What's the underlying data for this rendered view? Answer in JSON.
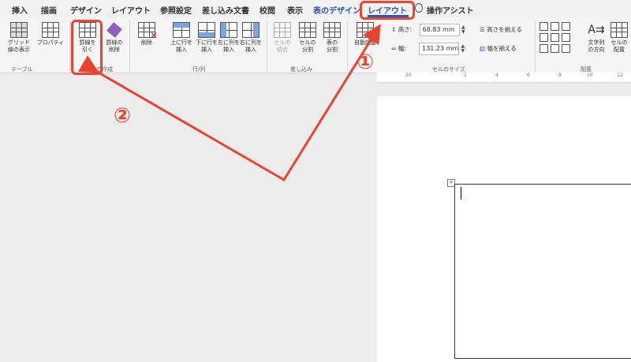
{
  "tabs": [
    {
      "label": "挿入",
      "kind": "normal"
    },
    {
      "label": "描画",
      "kind": "normal"
    },
    {
      "label": "デザイン",
      "kind": "normal"
    },
    {
      "label": "レイアウト",
      "kind": "normal"
    },
    {
      "label": "参照設定",
      "kind": "normal"
    },
    {
      "label": "差し込み文書",
      "kind": "normal"
    },
    {
      "label": "校閲",
      "kind": "normal"
    },
    {
      "label": "表示",
      "kind": "normal"
    },
    {
      "label": "表のデザイン",
      "kind": "context"
    },
    {
      "label": "レイアウト",
      "kind": "active"
    },
    {
      "label": "操作アシスト",
      "kind": "normal"
    }
  ],
  "ribbon": {
    "table": {
      "gridlines_label": "グリッド\n線の表示",
      "properties_label": "プロパティ",
      "group_label": "テーブル"
    },
    "draw": {
      "draw_table_label": "罫線を\n引く",
      "eraser_label": "罫線の\n削除",
      "group_label": "罫線の作成"
    },
    "rows_cols": {
      "delete_label": "削除",
      "insert_above_label": "上に行を\n挿入",
      "insert_below_label": "下に行を\n挿入",
      "insert_left_label": "左に列を\n挿入",
      "insert_right_label": "右に列を\n挿入",
      "group_label": "行/列"
    },
    "merge": {
      "merge_cells_label": "セルの\n結合",
      "split_cells_label": "セルの\n分割",
      "split_table_label": "表の\n分割",
      "group_label": "差し込み"
    },
    "autofit": {
      "label": "自動調整"
    },
    "cell_size": {
      "height_label": "高さ:",
      "height_value": "68.83 mm",
      "width_label": "幅:",
      "width_value": "131.23 mm",
      "distribute_rows_label": "高さを揃える",
      "distribute_cols_label": "幅を揃える",
      "group_label": "セルのサイズ"
    },
    "alignment": {
      "text_direction_label": "文字列\nの方向",
      "cell_margins_label": "セルの\n配置",
      "group_label": "配置"
    }
  },
  "ruler": {
    "ticks": [
      "20",
      "2",
      "4",
      "6",
      "8",
      "10",
      "12"
    ]
  },
  "annotations": {
    "marker1": "①",
    "marker2": "②"
  },
  "colors": {
    "accent": "#2b56b4",
    "annotation": "#e8442e"
  }
}
